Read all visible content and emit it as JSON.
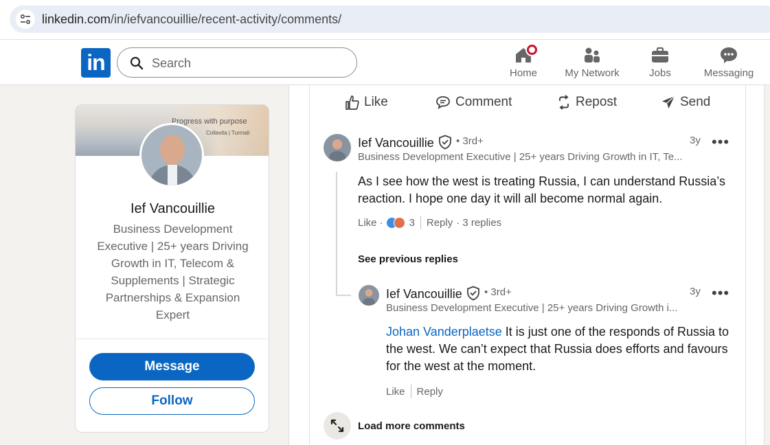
{
  "browser": {
    "url_host": "linkedin.com",
    "url_path": "/in/iefvancouillie/recent-activity/comments/"
  },
  "nav": {
    "logo": "in",
    "search_placeholder": "Search",
    "items": [
      {
        "label": "Home",
        "icon": "home-icon"
      },
      {
        "label": "My Network",
        "icon": "network-icon"
      },
      {
        "label": "Jobs",
        "icon": "briefcase-icon"
      },
      {
        "label": "Messaging",
        "icon": "messaging-icon"
      }
    ]
  },
  "profile": {
    "banner_title": "Progress with purpose",
    "banner_sub": "Collavita | Turmali",
    "name": "Ief Vancouillie",
    "headline": "Business Development Executive | 25+ years Driving Growth in IT, Telecom & Supplements | Strategic Partnerships & Expansion Expert",
    "message_label": "Message",
    "follow_label": "Follow"
  },
  "post_actions": {
    "like": "Like",
    "comment": "Comment",
    "repost": "Repost",
    "send": "Send"
  },
  "comment1": {
    "name": "Ief Vancouillie",
    "degree": "• 3rd+",
    "headline": "Business Development Executive | 25+ years Driving Growth in IT, Te...",
    "time": "3y",
    "text": "As I see how the west is treating Russia, I can understand Russia’s reaction. I hope one day it will all become normal again.",
    "like": "Like",
    "dot": "·",
    "reaction_count": "3",
    "reply": "Reply",
    "replies": "· 3 replies"
  },
  "see_previous": "See previous replies",
  "reply1": {
    "name": "Ief Vancouillie",
    "degree": "• 3rd+",
    "headline": "Business Development Executive | 25+ years Driving Growth i...",
    "time": "3y",
    "mention": "Johan Vanderplaetse",
    "text": " It is just one of the responds of Russia to the west. We can’t expect that Russia does efforts and favours for the west at the moment.",
    "like": "Like",
    "reply": "Reply"
  },
  "load_more": "Load more comments",
  "colors": {
    "brand": "#0a66c2",
    "badge": "#cb112d",
    "page_bg": "#f4f2ee"
  }
}
